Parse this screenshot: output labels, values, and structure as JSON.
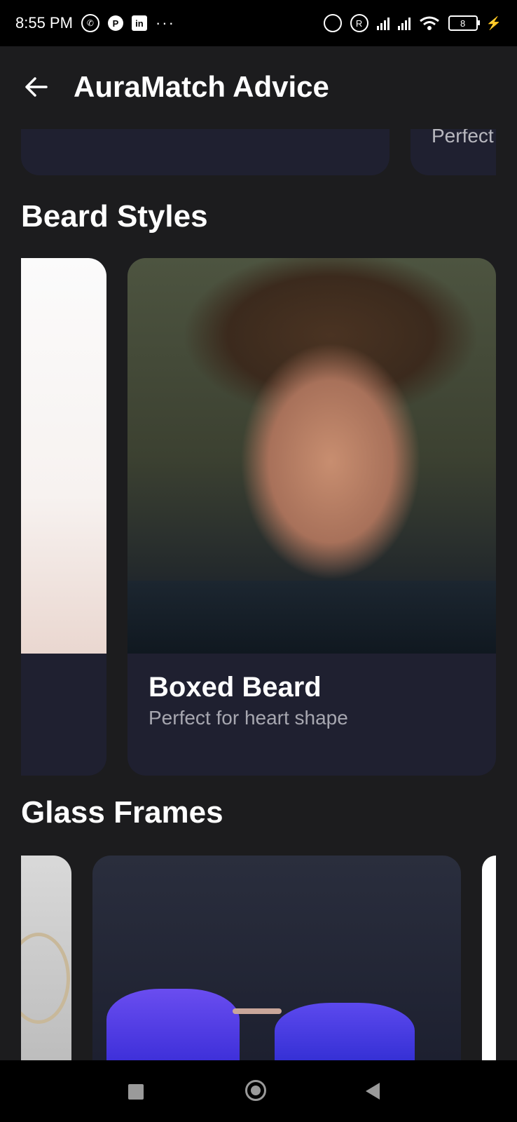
{
  "status_bar": {
    "time": "8:55 PM",
    "more": "···",
    "r_label": "R",
    "battery": "8",
    "icons": [
      "whatsapp-icon",
      "circle-p-icon",
      "linkedin-icon",
      "more-icon",
      "alarm-icon",
      "r-icon",
      "signal-icon",
      "signal-icon",
      "wifi-icon",
      "battery-icon",
      "charging-icon"
    ]
  },
  "app_bar": {
    "title": "AuraMatch Advice",
    "back_icon": "arrow-left-icon"
  },
  "top_row": {
    "partial_subtitle": "Perfect"
  },
  "sections": {
    "beard": {
      "title": "Beard Styles",
      "card": {
        "title": "Boxed Beard",
        "subtitle": "Perfect for heart shape"
      }
    },
    "glass": {
      "title": "Glass Frames"
    }
  },
  "nav_bar": {
    "icons": [
      "recent-apps-icon",
      "home-icon",
      "back-icon"
    ]
  },
  "colors": {
    "background": "#1c1c1e",
    "card": "#1f2030",
    "text_secondary": "#a7a7b0"
  }
}
